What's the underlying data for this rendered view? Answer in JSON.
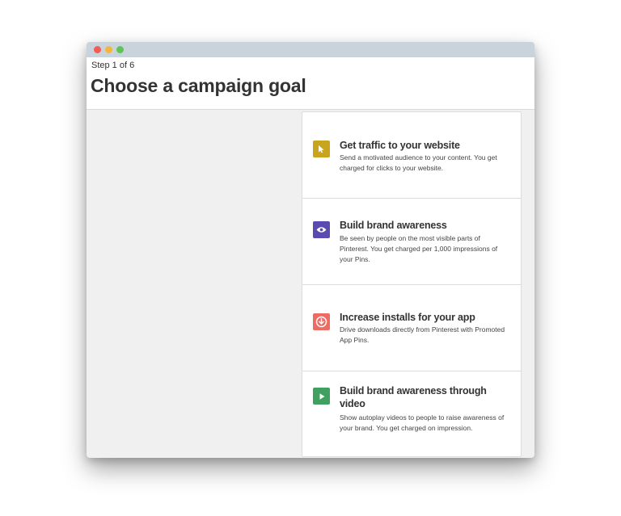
{
  "window": {
    "traffic_lights": [
      "close",
      "minimize",
      "maximize"
    ]
  },
  "header": {
    "step": "Step 1 of 6",
    "title": "Choose a campaign goal"
  },
  "goals": [
    {
      "title": "Get traffic to your website",
      "description": "Send a motivated audience to your content. You get charged for clicks to your website.",
      "icon": "cursor-icon",
      "color": "#c9a41d"
    },
    {
      "title": "Build brand awareness",
      "description": "Be seen by people on the most visible parts of Pinterest. You get charged per 1,000 impressions of your Pins.",
      "icon": "eye-icon",
      "color": "#5b4bb0"
    },
    {
      "title": "Increase installs for your app",
      "description": "Drive downloads directly from Pinterest with Promoted App Pins.",
      "icon": "download-icon",
      "color": "#ee6a62"
    },
    {
      "title": "Build brand awareness through video",
      "description": "Show autoplay videos to people to raise awareness of your brand. You get charged on impression.",
      "icon": "play-icon",
      "color": "#3fa060"
    }
  ]
}
